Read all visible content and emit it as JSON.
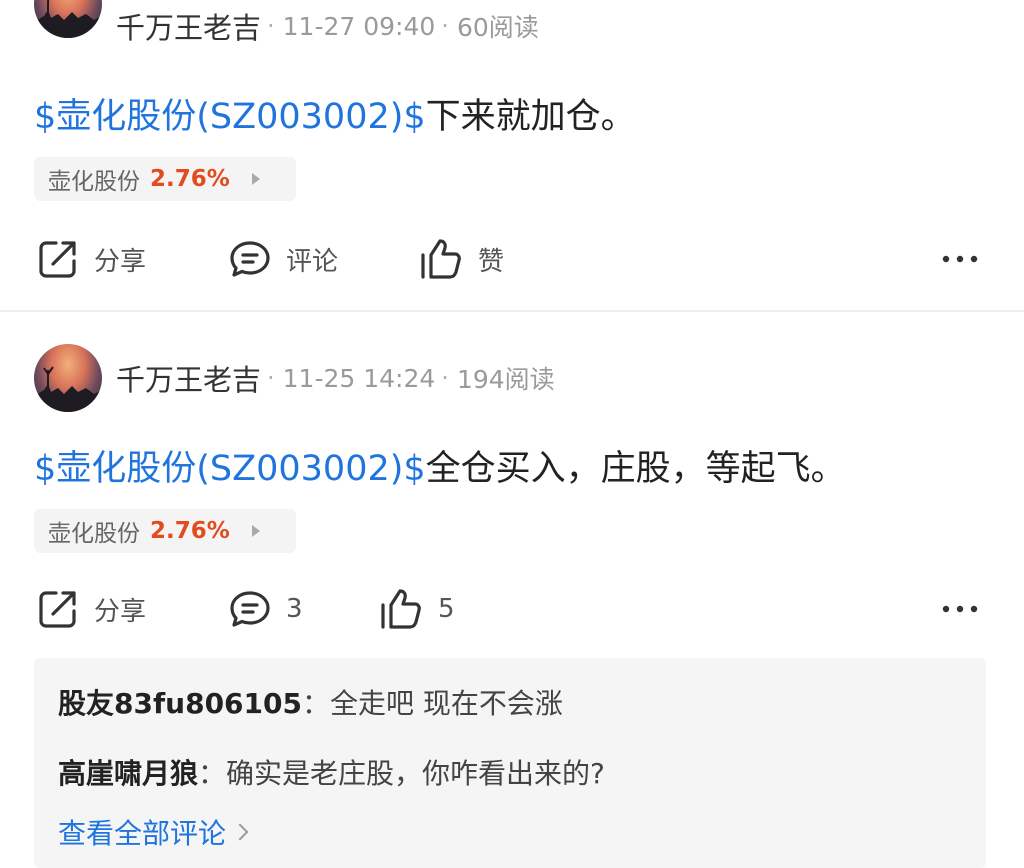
{
  "posts": [
    {
      "author": "千万王老吉",
      "time": "11-27 09:40",
      "reads": "60阅读",
      "stock_link": "$壶化股份(SZ003002)$",
      "text": "下来就加仓。",
      "chip": {
        "name": "壶化股份",
        "change": "2.76%"
      },
      "actions": {
        "share": "分享",
        "comment": "评论",
        "like": "赞"
      }
    },
    {
      "author": "千万王老吉",
      "time": "11-25 14:24",
      "reads": "194阅读",
      "stock_link": "$壶化股份(SZ003002)$",
      "text": "全仓买入，庄股，等起飞。",
      "chip": {
        "name": "壶化股份",
        "change": "2.76%"
      },
      "actions": {
        "share": "分享",
        "comment": "3",
        "like": "5"
      },
      "comments": [
        {
          "author": "股友83fu806105",
          "sep": "：",
          "text": "全走吧 现在不会涨"
        },
        {
          "author": "高崖啸月狼",
          "sep": "：",
          "text": "确实是老庄股，你咋看出来的?"
        }
      ],
      "view_all": "查看全部评论"
    }
  ],
  "colors": {
    "link": "#1f74dd",
    "up": "#e24b1e"
  },
  "icons": [
    "avatar-image",
    "share-icon",
    "comment-icon",
    "like-icon",
    "more-icon",
    "chevron-right-icon"
  ]
}
